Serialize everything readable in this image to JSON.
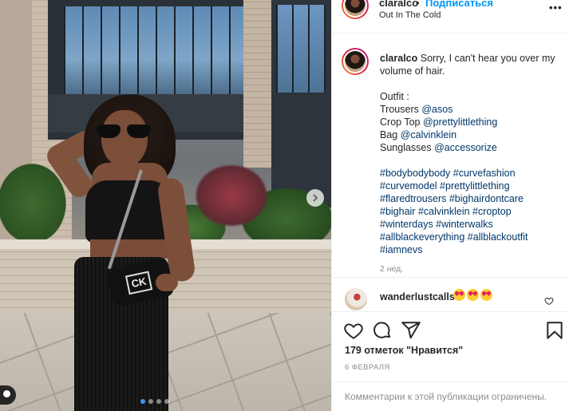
{
  "header": {
    "username": "claralco",
    "separator": "•",
    "follow_label": "Подписаться",
    "location": "Out In The Cold",
    "more_label": "•••"
  },
  "caption": {
    "username": "claralco",
    "text": "Sorry, I can't hear you over my volume of hair.",
    "outfit_title": "Outfit :",
    "outfit": [
      {
        "item": "Trousers",
        "tag": "@asos"
      },
      {
        "item": "Crop Top",
        "tag": "@prettylittlething"
      },
      {
        "item": "Bag",
        "tag": "@calvinklein"
      },
      {
        "item": "Sunglasses",
        "tag": "@accessorize"
      }
    ],
    "hashtags": [
      "#bodybodybody #curvefashion",
      "#curvemodel #prettylittlething",
      "#flaredtrousers #bighairdontcare",
      "#bighair #calvinklein #croptop",
      "#winterdays #winterwalks",
      "#allblackeverything #allblackoutfit",
      "#iamnevs"
    ],
    "time": "2 нед."
  },
  "comment": {
    "username": "wanderlustcalls",
    "emoji": [
      "heart-eyes",
      "heart-eyes",
      "heart-eyes"
    ]
  },
  "actions": {
    "likes": "179 отметок \"Нравится\"",
    "date": "6 ФЕВРАЛЯ"
  },
  "comments_disabled": "Комментарии к этой публикации ограничены.",
  "photo": {
    "bag_logo": "CK",
    "carousel_dots": 4,
    "active_dot": 0
  },
  "colors": {
    "follow_blue": "#0095f6",
    "link": "#00376b",
    "muted": "#8e8e8e",
    "text": "#262626"
  }
}
